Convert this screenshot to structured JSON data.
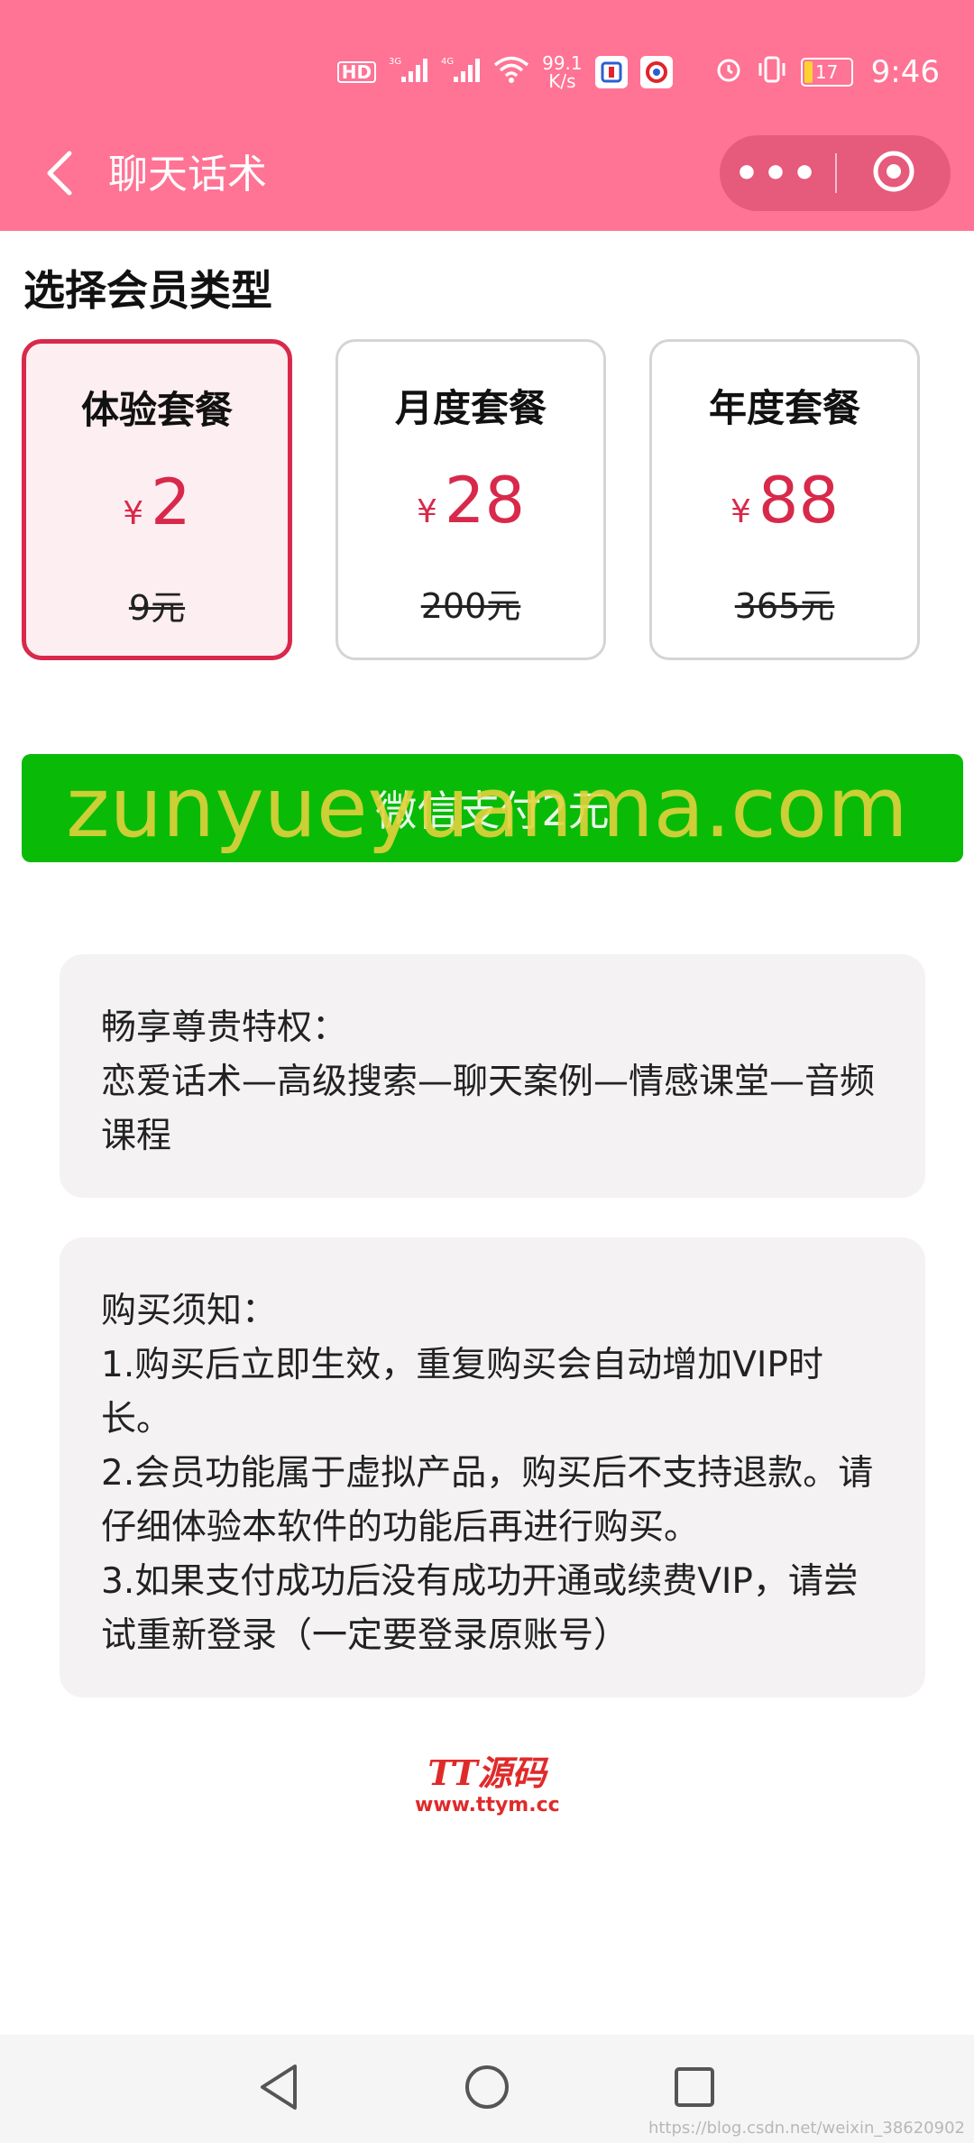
{
  "status_bar": {
    "network_hd": "HD",
    "network_1": "3G",
    "network_2": "4G",
    "speed_value": "99.1",
    "speed_unit": "K/s",
    "battery_level": "17",
    "battery_fraction": 0.17,
    "time": "9:46",
    "icons": [
      "hd-icon",
      "signal-icon",
      "signal-icon",
      "wifi-icon",
      "app-icon",
      "app-icon",
      "alarm-icon",
      "vibrate-icon",
      "battery-icon"
    ]
  },
  "nav": {
    "title": "聊天话术",
    "back_icon": "chevron-left-icon",
    "more_label": "•••",
    "close_icon": "target-circle-icon"
  },
  "section_title": "选择会员类型",
  "plans": [
    {
      "name": "体验套餐",
      "currency": "¥",
      "price": "2",
      "original": "9元",
      "selected": true
    },
    {
      "name": "月度套餐",
      "currency": "¥",
      "price": "28",
      "original": "200元",
      "selected": false
    },
    {
      "name": "年度套餐",
      "currency": "¥",
      "price": "88",
      "original": "365元",
      "selected": false
    }
  ],
  "pay_button": "微信支付2元",
  "watermark": "zunyueyuanma.com",
  "privileges": {
    "title": "畅享尊贵特权：",
    "text": "恋爱话术—高级搜索—聊天案例—情感课堂—音频课程"
  },
  "notice": {
    "title": "购买须知：",
    "lines": [
      "1.购买后立即生效，重复购买会自动增加VIP时长。",
      "2.会员功能属于虚拟产品，购买后不支持退款。请仔细体验本软件的功能后再进行购买。",
      "3.如果支付成功后没有成功开通或续费VIP，请尝试重新登录（一定要登录原账号）"
    ]
  },
  "logo": {
    "main": "TT源码",
    "url": "www.ttym.cc"
  },
  "footer_mark": "https://blog.csdn.net/weixin_38620902",
  "colors": {
    "primary_pink": "#ff7394",
    "accent_red": "#d8294b",
    "wechat_green": "#09bb07"
  }
}
